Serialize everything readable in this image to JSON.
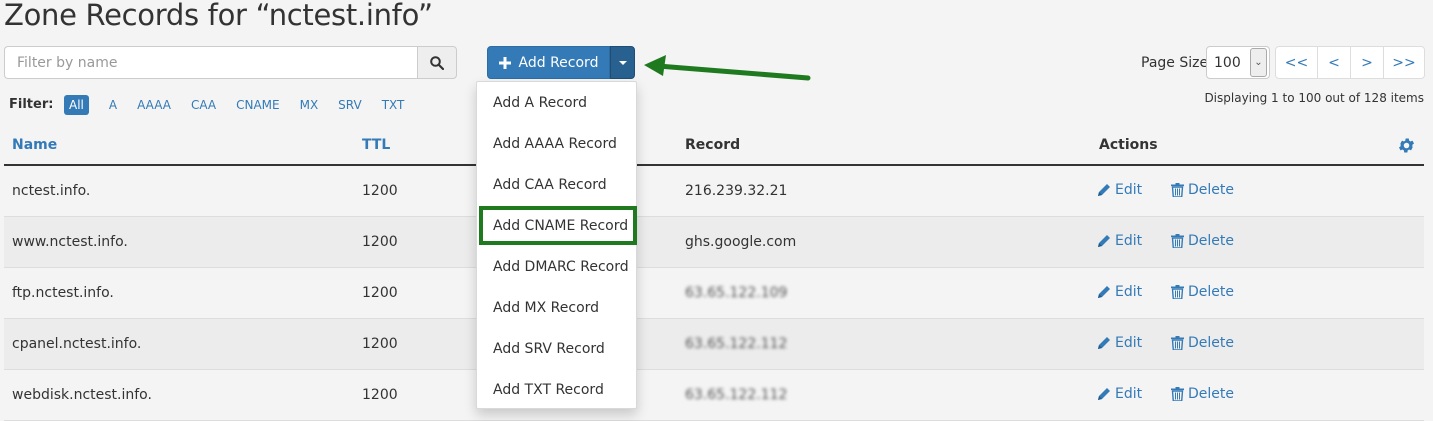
{
  "page_title": "Zone Records for “nctest.info”",
  "search": {
    "placeholder": "Filter by name"
  },
  "add_record": {
    "label": "Add Record"
  },
  "dropdown": {
    "items": [
      "Add A Record",
      "Add AAAA Record",
      "Add CAA Record",
      "Add CNAME Record",
      "Add DMARC Record",
      "Add MX Record",
      "Add SRV Record",
      "Add TXT Record"
    ],
    "highlighted_index": 3
  },
  "page_size": {
    "label": "Page Size",
    "value": "100"
  },
  "pager": {
    "first": "<<",
    "prev": "<",
    "next": ">",
    "last": ">>"
  },
  "displaying": "Displaying 1 to 100 out of 128 items",
  "filter": {
    "label": "Filter:",
    "items": [
      "All",
      "A",
      "AAAA",
      "CAA",
      "CNAME",
      "MX",
      "SRV",
      "TXT"
    ],
    "active": "All"
  },
  "table": {
    "headers": {
      "name": "Name",
      "ttl": "TTL",
      "record": "Record",
      "actions": "Actions"
    },
    "rows": [
      {
        "name": "nctest.info.",
        "ttl": "1200",
        "record": "216.239.32.21",
        "blurred": false
      },
      {
        "name": "www.nctest.info.",
        "ttl": "1200",
        "record": "ghs.google.com",
        "blurred": false
      },
      {
        "name": "ftp.nctest.info.",
        "ttl": "1200",
        "record": "63.65.122.109",
        "blurred": true
      },
      {
        "name": "cpanel.nctest.info.",
        "ttl": "1200",
        "record": "63.65.122.112",
        "blurred": true
      },
      {
        "name": "webdisk.nctest.info.",
        "ttl": "1200",
        "record": "63.65.122.112",
        "blurred": true
      }
    ],
    "edit_label": "Edit",
    "delete_label": "Delete"
  },
  "colors": {
    "primary": "#337ab7",
    "highlight": "#1f7a1f",
    "arrow": "#1f7a1f"
  }
}
